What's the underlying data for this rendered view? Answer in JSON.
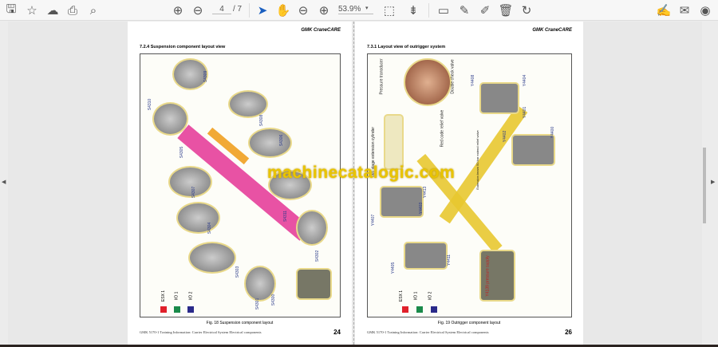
{
  "toolbar": {
    "current_page": "4",
    "total_pages": "/ 7",
    "zoom": "53.9%"
  },
  "page_left": {
    "header": "GMK CraneCARE",
    "section": "7.2.4  Suspension component layout view",
    "caption": "Fig. 18 Suspension component layout",
    "footer": "GMK 5170-1 Training Information: Carrier Electrical System     Electrical components",
    "page_number": "24",
    "labels": [
      "S4309",
      "S4310",
      "S4308",
      "S4305",
      "S4306",
      "S4307",
      "S4311",
      "S4304",
      "S4302",
      "S4303",
      "S4301",
      "S4300"
    ],
    "legend": [
      {
        "label": "ESX 1",
        "color": "#e0202a"
      },
      {
        "label": "I/O 1",
        "color": "#1a8a4a"
      },
      {
        "label": "I/O 2",
        "color": "#2a2a8a"
      }
    ]
  },
  "page_right": {
    "header": "GMK CraneCARE",
    "section": "7.3.1  Layout view of outrigger system",
    "caption": "Fig. 19 Outrigger component layout",
    "footer": "GMK 5170-1 Training Information: Carrier Electrical System     Electrical components",
    "page_number": "26",
    "callouts": [
      "Pressure transducer",
      "Double check valve",
      "Two stage extension cylinder",
      "Red code relief valve",
      "Extension beam 50 bar extend relief valve",
      "Y4139 pressure supply"
    ],
    "labels": [
      "Y4408",
      "Y4404",
      "Y4401",
      "Y4402",
      "Y4400",
      "Y4407",
      "Y4403",
      "Y4413",
      "Y4405",
      "Y4411"
    ],
    "legend": [
      {
        "label": "ESX 1",
        "color": "#e0202a"
      },
      {
        "label": "I/O 1",
        "color": "#1a8a4a"
      },
      {
        "label": "I/O 2",
        "color": "#2a2a8a"
      }
    ]
  },
  "watermark": "machinecatalogic.com"
}
